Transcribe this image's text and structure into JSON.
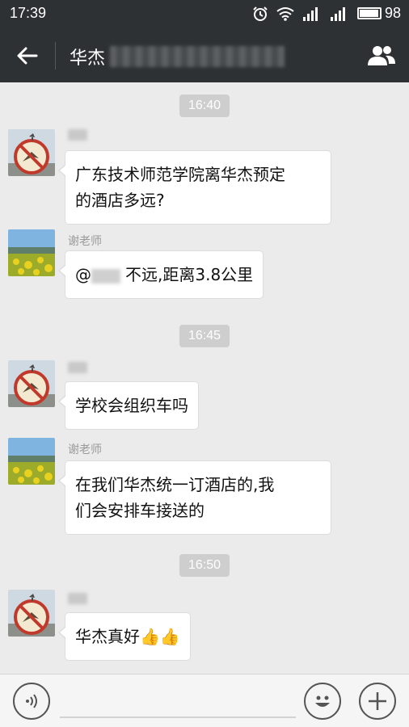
{
  "status_bar": {
    "time": "17:39",
    "battery_level": "98",
    "battery_fraction": 0.98
  },
  "header": {
    "title": "华杰"
  },
  "messages": [
    {
      "type": "time",
      "text": "16:40"
    },
    {
      "type": "msg",
      "sender": "",
      "avatar": "no-bird-sign",
      "text_lines": [
        "广东技术师范学院离华杰预定",
        "的酒店多远?"
      ]
    },
    {
      "type": "msg",
      "sender": "谢老师",
      "avatar": "landscape",
      "prefix": "@",
      "text": "不远,距离3.8公里"
    },
    {
      "type": "time",
      "text": "16:45"
    },
    {
      "type": "msg",
      "sender": "",
      "avatar": "no-bird-sign",
      "text": "学校会组织车吗"
    },
    {
      "type": "msg",
      "sender": "谢老师",
      "avatar": "landscape",
      "text_lines": [
        "在我们华杰统一订酒店的,我",
        "们会安排车接送的"
      ]
    },
    {
      "type": "time",
      "text": "16:50"
    },
    {
      "type": "msg",
      "sender": "",
      "avatar": "no-bird-sign",
      "text": "华杰真好",
      "emoji": "👍👍"
    }
  ],
  "icons": {
    "back": "back-arrow-icon",
    "members": "members-icon",
    "voice": "voice-icon",
    "emoji": "smiley-icon",
    "more": "plus-icon"
  },
  "colors": {
    "bar": "#2e3134",
    "chat_bg": "#ebebeb",
    "bubble": "#ffffff",
    "time_badge": "#cecece"
  }
}
